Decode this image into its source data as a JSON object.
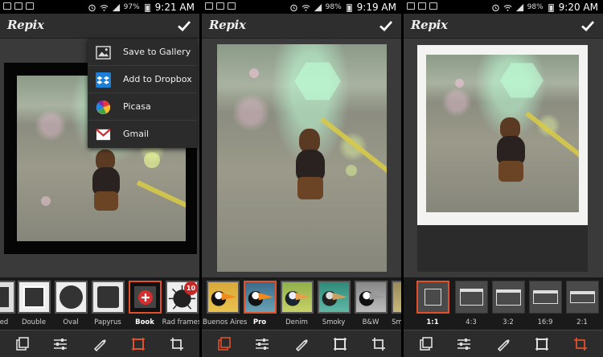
{
  "app": {
    "logo": "Repix"
  },
  "panels": [
    {
      "status": {
        "battery": "97%",
        "time": "9:21 AM"
      }
    },
    {
      "status": {
        "battery": "98%",
        "time": "9:19 AM"
      }
    },
    {
      "status": {
        "battery": "98%",
        "time": "9:20 AM"
      }
    }
  ],
  "share_menu": {
    "items": [
      {
        "label": "Save to Gallery",
        "icon": "image-icon"
      },
      {
        "label": "Add to Dropbox",
        "icon": "dropbox-icon"
      },
      {
        "label": "Picasa",
        "icon": "picasa-icon"
      },
      {
        "label": "Gmail",
        "icon": "gmail-icon"
      }
    ]
  },
  "frames_strip": {
    "items": [
      {
        "label": "ed"
      },
      {
        "label": "Double"
      },
      {
        "label": "Oval"
      },
      {
        "label": "Papyrus"
      },
      {
        "label": "Book",
        "selected": true
      },
      {
        "label": "Rad frames",
        "badge": "10"
      }
    ]
  },
  "filters_strip": {
    "items": [
      {
        "label": "Buenos Aires"
      },
      {
        "label": "Pro",
        "selected": true
      },
      {
        "label": "Denim"
      },
      {
        "label": "Smoky"
      },
      {
        "label": "B&W"
      },
      {
        "label": "Sm"
      }
    ]
  },
  "crop_strip": {
    "items": [
      {
        "label": "1:1",
        "selected": true
      },
      {
        "label": "4:3"
      },
      {
        "label": "3:2"
      },
      {
        "label": "16:9"
      },
      {
        "label": "2:1"
      }
    ]
  },
  "colors": {
    "accent": "#e0502a",
    "appbar": "#2e2e2e",
    "strip": "#1a1a1a"
  },
  "toolbar": {
    "icons": [
      "frames-icon",
      "sliders-icon",
      "brush-icon",
      "frame-crop-icon",
      "crop-icon"
    ]
  }
}
